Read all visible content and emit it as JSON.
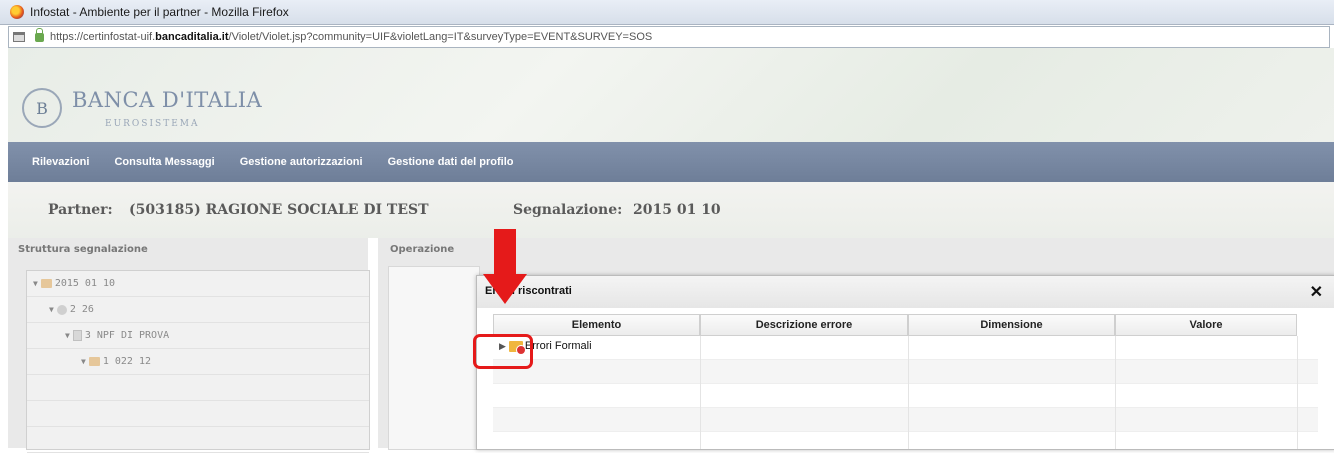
{
  "browser": {
    "title": "Infostat - Ambiente per il partner - Mozilla Firefox",
    "url_prefix": "https://certinfostat-uif.",
    "url_domain": "bancaditalia.it",
    "url_suffix": "/Violet/Violet.jsp?community=UIF&violetLang=IT&surveyType=EVENT&SURVEY=SOS"
  },
  "logo": {
    "emblem": "B",
    "name": "BANCA D'ITALIA",
    "subtitle": "EUROSISTEMA"
  },
  "nav": {
    "items": [
      "Rilevazioni",
      "Consulta Messaggi",
      "Gestione autorizzazioni",
      "Gestione dati del profilo"
    ]
  },
  "info": {
    "partner_label": "Partner:",
    "partner_value": "(503185) RAGIONE SOCIALE DI TEST",
    "segnalazione_label": "Segnalazione:",
    "segnalazione_value": "2015 01 10"
  },
  "left_panel": {
    "title": "Struttura segnalazione",
    "tree": [
      {
        "label": "2015 01 10",
        "icon": "folder-icon"
      },
      {
        "label": "2 26",
        "icon": "circle-icon"
      },
      {
        "label": "3 NPF DI PROVA",
        "icon": "document-icon"
      },
      {
        "label": "1 022 12",
        "icon": "folder-icon"
      }
    ]
  },
  "right_panel": {
    "title": "Operazione"
  },
  "dialog": {
    "title": "Errori riscontrati",
    "close_label": "✕",
    "columns": [
      "Elemento",
      "Descrizione errore",
      "Dimensione",
      "Valore"
    ],
    "rows": [
      {
        "elemento": "Errori Formali",
        "descrizione": "",
        "dimensione": "",
        "valore": ""
      }
    ]
  },
  "colors": {
    "navbar": "#76869f",
    "highlight": "#e51a1a",
    "accent": "#7e8fa8"
  }
}
